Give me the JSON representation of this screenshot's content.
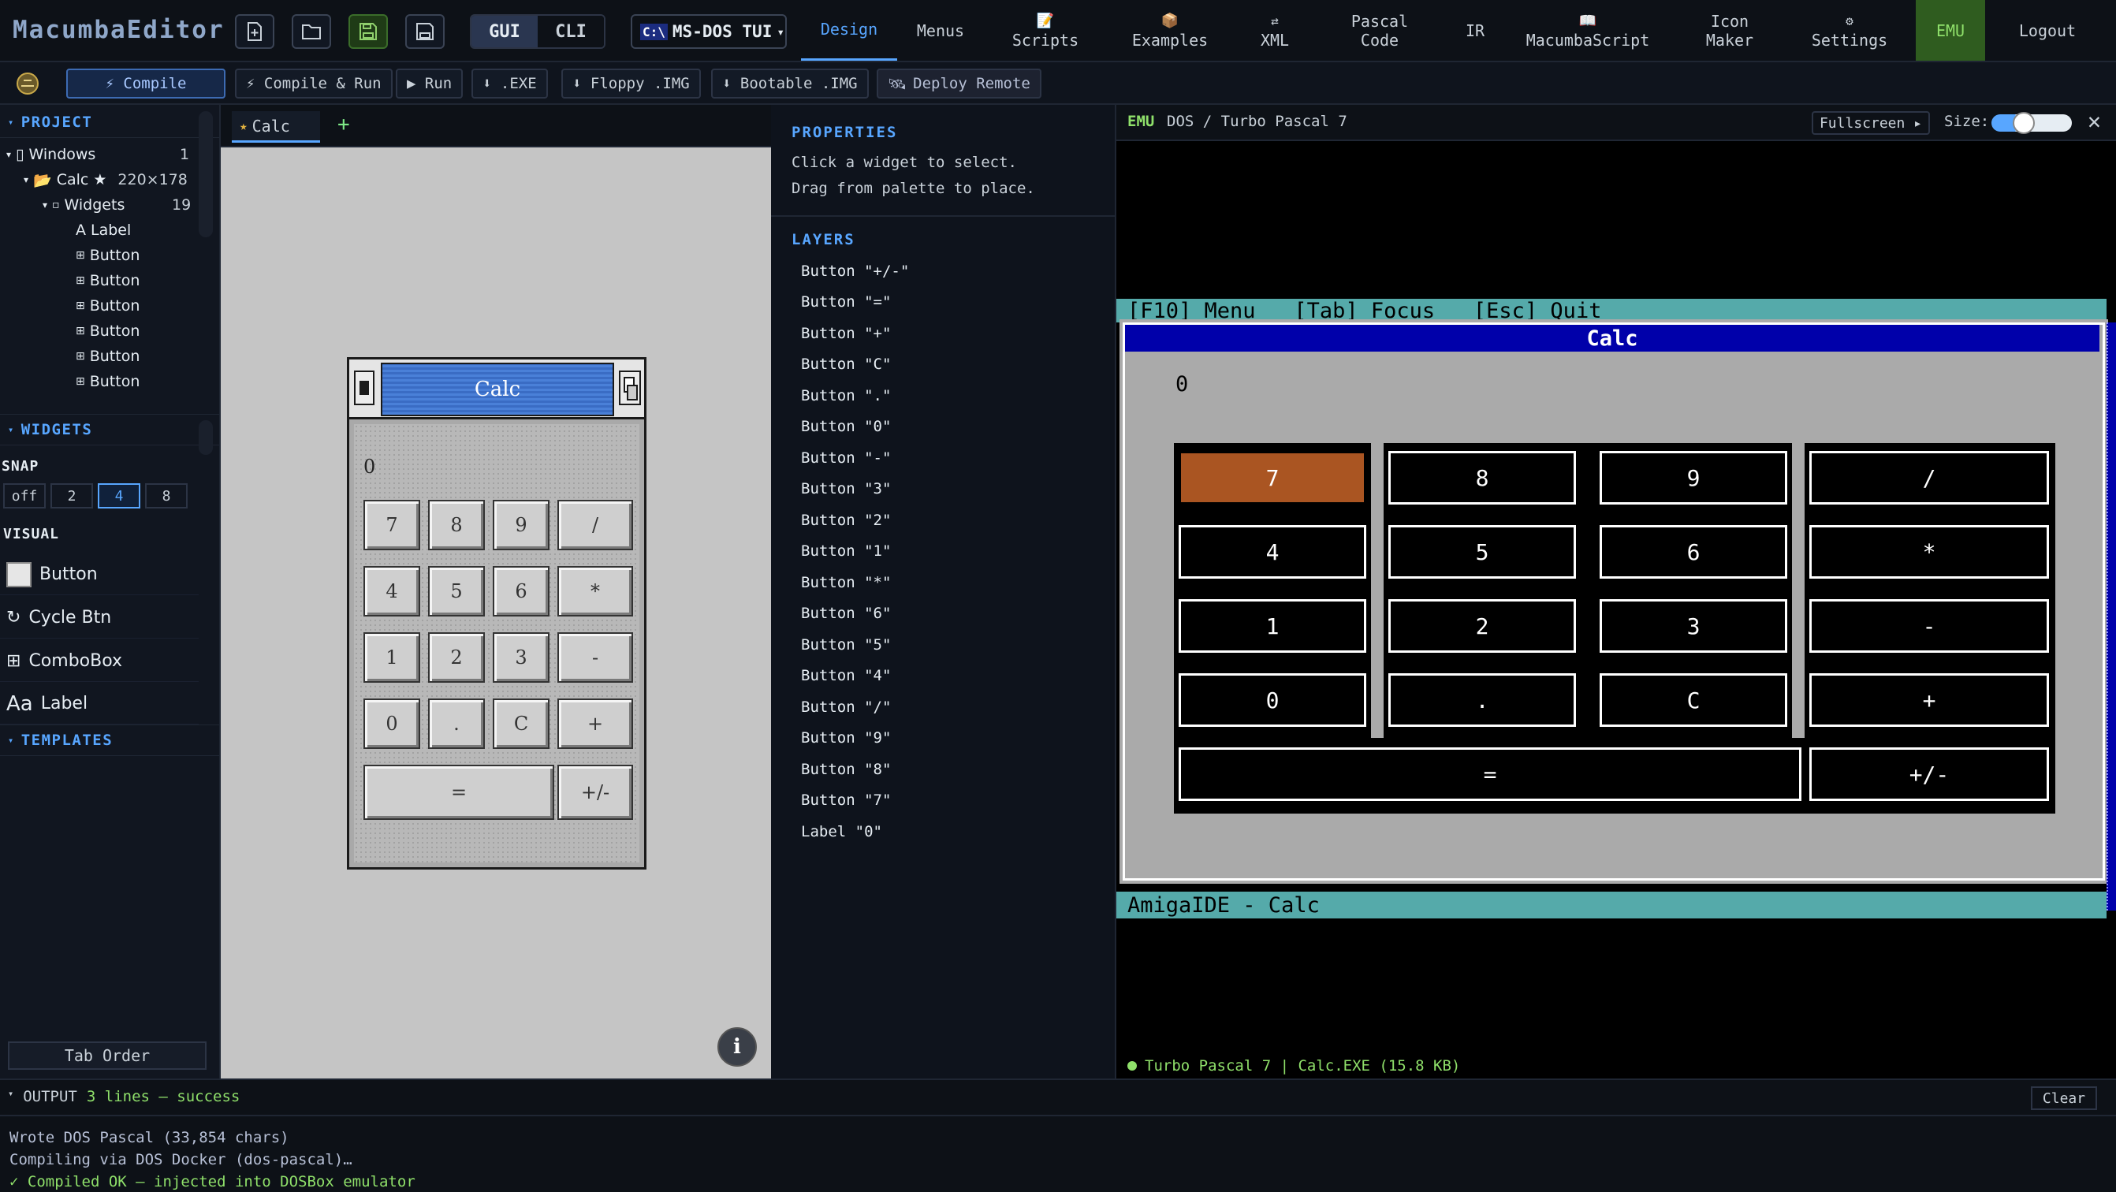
{
  "app": {
    "brand": "MacumbaEditor",
    "mode_gui": "GUI",
    "mode_cli": "CLI",
    "target_prefix": "C:\\",
    "target": "MS-DOS TUI",
    "target_caret": "▾"
  },
  "nav": {
    "design": "Design",
    "menus": "Menus",
    "scripts": "Scripts",
    "examples": "Examples",
    "xml": "XML",
    "pascal_line1": "Pascal",
    "pascal_line2": "Code",
    "ir": "IR",
    "macumbascript": "MacumbaScript",
    "icon_line1": "Icon",
    "icon_line2": "Maker",
    "settings": "Settings",
    "emu": "EMU",
    "logout": "Logout"
  },
  "toolbar": {
    "compile": "⚡ Compile",
    "compile_run": "⚡ Compile & Run",
    "run": "▶ Run",
    "exe": "⬇ .EXE",
    "floppy": "⬇ Floppy .IMG",
    "bootable": "⬇ Bootable .IMG",
    "deploy": "Deploy Remote"
  },
  "project": {
    "title": "PROJECT",
    "windows_label": "Windows",
    "windows_count": "1",
    "calc_label": "Calc",
    "calc_star": "★",
    "calc_size": "220×178",
    "widgets_label": "Widgets",
    "widgets_count": "19",
    "items": [
      "Label",
      "Button",
      "Button",
      "Button",
      "Button",
      "Button",
      "Button"
    ]
  },
  "widgets_panel": {
    "title": "WIDGETS",
    "snap_label": "SNAP",
    "snap_options": [
      "off",
      "2",
      "4",
      "8"
    ],
    "snap_selected": "4",
    "visual_label": "VISUAL",
    "items": [
      "Button",
      "Cycle Btn",
      "ComboBox",
      "Label"
    ],
    "templates_title": "TEMPLATES",
    "tab_order": "Tab Order"
  },
  "canvas": {
    "tab_label": "Calc",
    "tab_star": "★",
    "add_tab": "+",
    "window_title": "Calc",
    "display_value": "0",
    "buttons": [
      "7",
      "8",
      "9",
      "/",
      "4",
      "5",
      "6",
      "*",
      "1",
      "2",
      "3",
      "-",
      "0",
      ".",
      "C",
      "+",
      "=",
      "+/-"
    ],
    "info": "i"
  },
  "properties": {
    "title": "PROPERTIES",
    "hint1": "Click a widget to select.",
    "hint2": "Drag from palette to place.",
    "layers_title": "LAYERS",
    "layers": [
      "Button \"+/-\"",
      "Button \"=\"",
      "Button \"+\"",
      "Button \"C\"",
      "Button \".\"",
      "Button \"0\"",
      "Button \"-\"",
      "Button \"3\"",
      "Button \"2\"",
      "Button \"1\"",
      "Button \"*\"",
      "Button \"6\"",
      "Button \"5\"",
      "Button \"4\"",
      "Button \"/\"",
      "Button \"9\"",
      "Button \"8\"",
      "Button \"7\"",
      "Label \"0\""
    ]
  },
  "emulator": {
    "label": "EMU",
    "title": "DOS / Turbo Pascal 7",
    "fullscreen": "Fullscreen ▸",
    "size_label": "Size:",
    "size_value": 0.3,
    "close": "✕",
    "menubar": "[F10] Menu   [Tab] Focus   [Esc] Quit",
    "window_title": "Calc",
    "display_value": "0",
    "buttons": [
      "7",
      "8",
      "9",
      "/",
      "4",
      "5",
      "6",
      "*",
      "1",
      "2",
      "3",
      "-",
      "0",
      ".",
      "C",
      "+",
      "=",
      "+/-"
    ],
    "focused_button": "7",
    "status": "AmigaIDE - Calc",
    "footer": "Turbo Pascal 7 | Calc.EXE (15.8 KB)"
  },
  "output": {
    "label": "OUTPUT",
    "summary": "3 lines — success",
    "clear": "Clear",
    "lines": [
      "Wrote DOS Pascal (33,854 chars)",
      "Compiling via DOS Docker (dos-pascal)…",
      "✓ Compiled OK — injected into DOSBox emulator"
    ]
  },
  "colors": {
    "accent": "#58a6ff",
    "success": "#8fe06a",
    "dos_blue": "#0000aa",
    "dos_cyan": "#55aaaa",
    "dos_focus": "#aa5522",
    "amiga_blue": "#4a80d8"
  }
}
